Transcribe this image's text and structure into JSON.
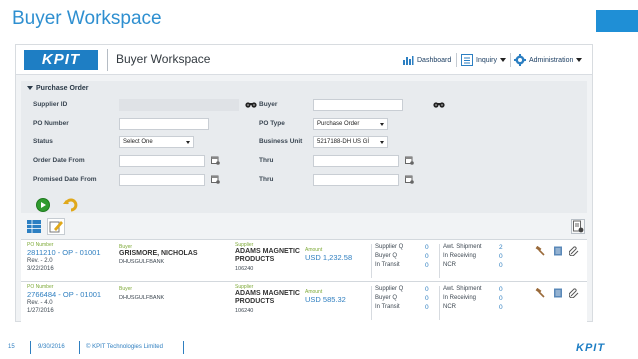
{
  "slide": {
    "title": "Buyer Workspace",
    "footer_number": "15",
    "footer_date": "9/30/2016",
    "footer_copyright": "© KPIT Technologies Limited",
    "footer_logo": "KPIT",
    "accent_color": "#1f8fd6"
  },
  "app": {
    "logo": "KPIT",
    "title": "Buyer Workspace",
    "nav": {
      "dashboard": "Dashboard",
      "inquiry": "Inquiry",
      "administration": "Administration"
    }
  },
  "form": {
    "section_title": "Purchase Order",
    "supplier_id_label": "Supplier ID",
    "po_number_label": "PO Number",
    "status_label": "Status",
    "status_value": "Select One",
    "order_date_from_label": "Order Date From",
    "promised_date_from_label": "Promised Date From",
    "buyer_label": "Buyer",
    "po_type_label": "PO Type",
    "po_type_value": "Purchase Order",
    "business_unit_label": "Business Unit",
    "business_unit_value": "5217188-DH US Gİ",
    "thru_label": "Thru",
    "thru_label_2": "Thru"
  },
  "rows": [
    {
      "po_caption": "PO Number",
      "po_number": "2811210 - OP - 01001",
      "rev": "Rev. - 2.0",
      "date": "3/22/2016",
      "buyer_caption": "Buyer",
      "buyer_name": "GRISMORE, NICHOLAS",
      "buyer_code": "DHUSGULFBANK",
      "supplier_caption": "Supplier",
      "supplier_name_1": "ADAMS MAGNETIC",
      "supplier_name_2": "PRODUCTS",
      "supplier_code": "106240",
      "amount_caption": "Amount",
      "amount": "USD 1,232.58",
      "supplier_q_label": "Supplier Q",
      "supplier_q": "0",
      "buyer_q_label": "Buyer Q",
      "buyer_q": "0",
      "in_transit_label": "In Transit",
      "in_transit": "0",
      "awt_shipment_label": "Awt. Shipment",
      "awt_shipment": "2",
      "in_receiving_label": "In Receiving",
      "in_receiving": "0",
      "ncr_label": "NCR",
      "ncr": "0"
    },
    {
      "po_caption": "PO Number",
      "po_number": "2766484 - OP - 01001",
      "rev": "Rev. - 4.0",
      "date": "1/27/2016",
      "buyer_caption": "Buyer",
      "buyer_name": "",
      "buyer_code": "DHUSGULFBANK",
      "supplier_caption": "Supplier",
      "supplier_name_1": "ADAMS MAGNETIC",
      "supplier_name_2": "PRODUCTS",
      "supplier_code": "106240",
      "amount_caption": "Amount",
      "amount": "USD 585.32",
      "supplier_q_label": "Supplier Q",
      "supplier_q": "0",
      "buyer_q_label": "Buyer Q",
      "buyer_q": "0",
      "in_transit_label": "In Transit",
      "in_transit": "0",
      "awt_shipment_label": "Awt. Shipment",
      "awt_shipment": "0",
      "in_receiving_label": "In Receiving",
      "in_receiving": "0",
      "ncr_label": "NCR",
      "ncr": "0"
    }
  ]
}
